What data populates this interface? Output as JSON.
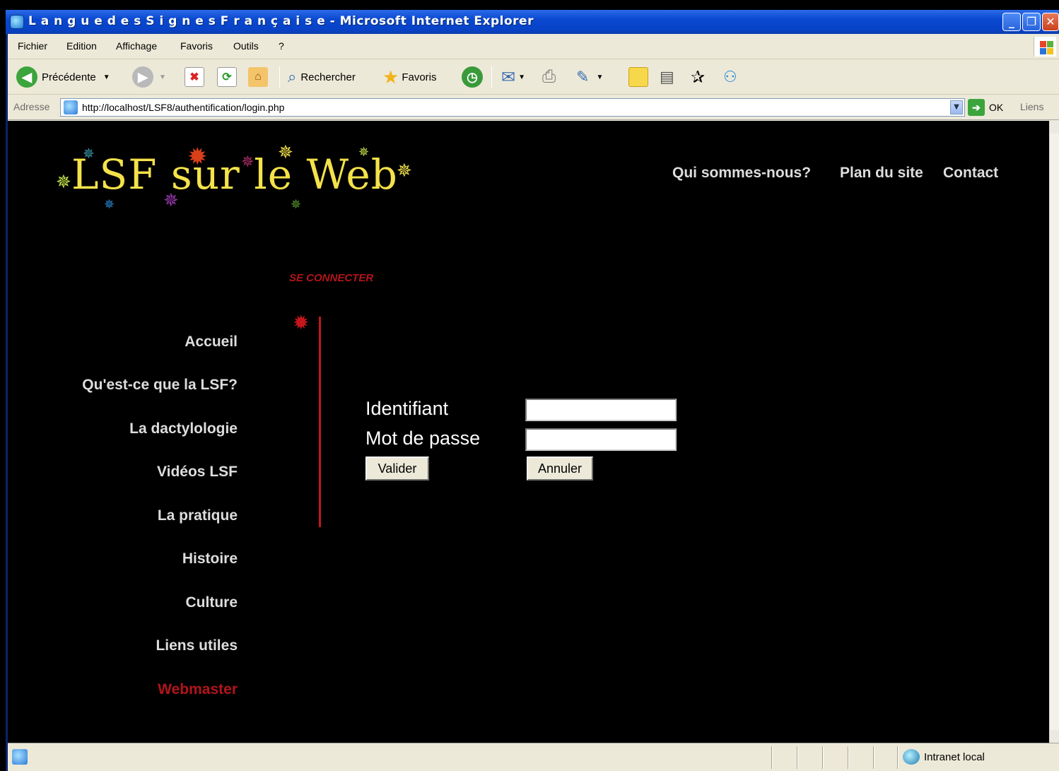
{
  "window": {
    "title": "L a n g u e d e s S i g n e s F r a n ç a i s e - Microsoft Internet Explorer",
    "buttons": {
      "minimize": "_",
      "maximize": "❐",
      "close": "✕"
    }
  },
  "menubar": {
    "items": [
      "Fichier",
      "Edition",
      "Affichage",
      "Favoris",
      "Outils",
      "?"
    ]
  },
  "toolbar": {
    "back_label": "Précédente",
    "search_label": "Rechercher",
    "favorites_label": "Favoris"
  },
  "address": {
    "label": "Adresse",
    "url": "http://localhost/LSF8/authentification/login.php",
    "go_label": "OK",
    "links_label": "Liens"
  },
  "site": {
    "logo_text": "LSF sur le Web",
    "top_nav": [
      "Qui sommes-nous?",
      "Plan du site",
      "Contact"
    ],
    "section_title": "SE CONNECTER",
    "side_nav": [
      "Accueil",
      "Qu'est-ce que la LSF?",
      "La dactylologie",
      "Vidéos LSF",
      "La pratique",
      "Histoire",
      "Culture",
      "Liens utiles",
      "Webmaster"
    ],
    "active_item": "Webmaster",
    "colors": {
      "accent_red": "#b3141b",
      "logo_yellow": "#f4e24a",
      "background": "#000000"
    }
  },
  "login_form": {
    "username_label": "Identifiant",
    "username_value": "",
    "password_label": "Mot de passe",
    "password_value": "",
    "submit_label": "Valider",
    "cancel_label": "Annuler"
  },
  "statusbar": {
    "zone": "Intranet local"
  }
}
